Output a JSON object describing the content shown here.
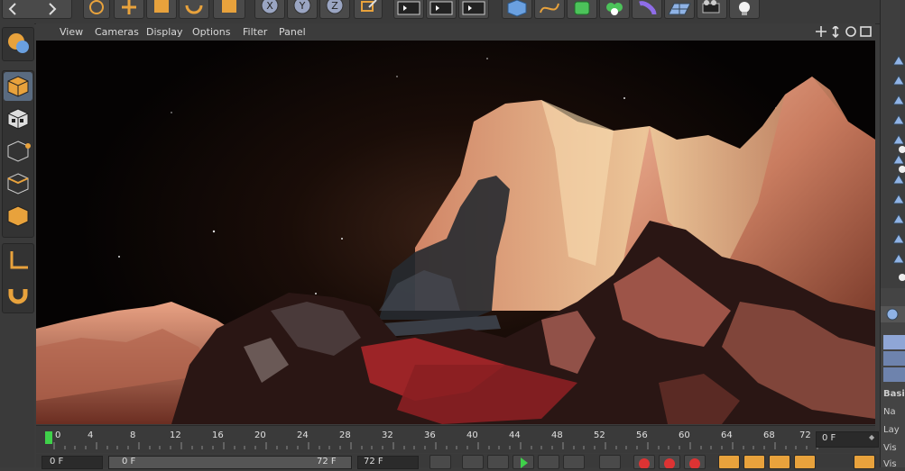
{
  "viewport_menu": [
    "View",
    "Cameras",
    "Display",
    "Options",
    "Filter",
    "Panel"
  ],
  "viewport_nav_icons": [
    "move-view-icon",
    "zoom-view-icon",
    "rotate-view-icon",
    "maximize-view-icon"
  ],
  "toolbar": {
    "axis_buttons": [
      "X",
      "Y",
      "Z"
    ]
  },
  "timeline": {
    "ticks": [
      "0",
      "4",
      "8",
      "12",
      "16",
      "20",
      "24",
      "28",
      "32",
      "36",
      "40",
      "44",
      "48",
      "52",
      "56",
      "60",
      "64",
      "68",
      "72"
    ],
    "current_frame": "0 F"
  },
  "bottom": {
    "start_field": "0 F",
    "min_field": "0 F",
    "max_field": "72 F",
    "end_field": "72 F"
  },
  "right_panel": {
    "tab_label": "Basic",
    "rows": [
      "Na",
      "Lay",
      "Vis",
      "Vis"
    ]
  },
  "colors": {
    "accent_orange": "#e8a23c",
    "timeline_marker": "#3fd14a",
    "panel_dark": "#3a3a3a",
    "active_button": "#5a6b80"
  }
}
